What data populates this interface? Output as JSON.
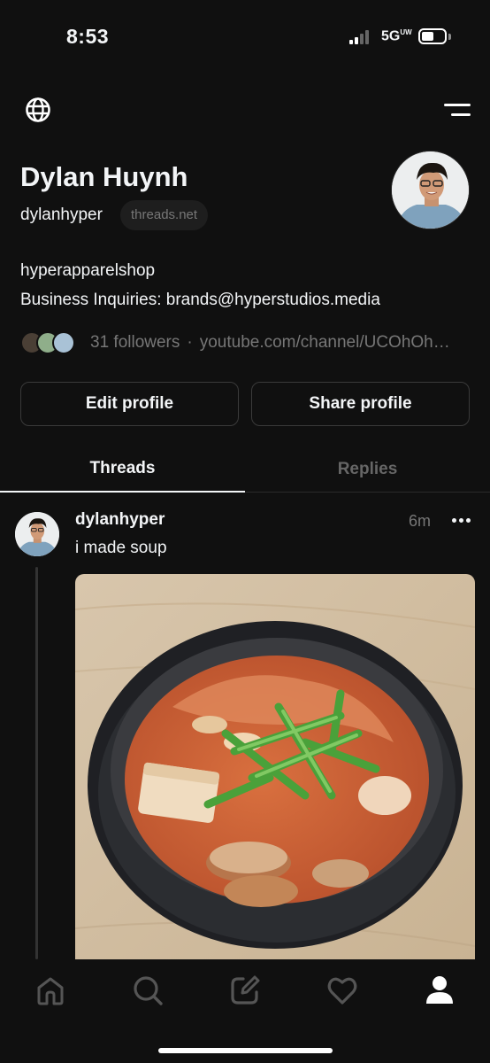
{
  "status_bar": {
    "time": "8:53",
    "network": "5G",
    "network_suffix": "UW"
  },
  "header": {
    "left_icon": "globe-icon",
    "right_icon": "menu-icon"
  },
  "profile": {
    "name": "Dylan Huynh",
    "handle": "dylanhyper",
    "domain_badge": "threads.net",
    "bio_line1": "hyperapparelshop",
    "bio_line2": "Business Inquiries: brands@hyperstudios.media",
    "followers": "31 followers",
    "separator": "·",
    "link": "youtube.com/channel/UCOhOhOhOhOh"
  },
  "buttons": {
    "edit": "Edit profile",
    "share": "Share profile"
  },
  "tabs": {
    "threads": "Threads",
    "replies": "Replies",
    "active": "Threads"
  },
  "post": {
    "username": "dylanhyper",
    "time": "6m",
    "text": "i made soup",
    "more_icon": "more-icon"
  },
  "bottom_nav": {
    "items": [
      "home-icon",
      "search-icon",
      "compose-icon",
      "heart-icon",
      "profile-icon"
    ],
    "active": "profile-icon"
  },
  "colors": {
    "background": "#101010",
    "text": "#f3f5f7",
    "muted": "#777777",
    "border": "#3a3a3a"
  }
}
